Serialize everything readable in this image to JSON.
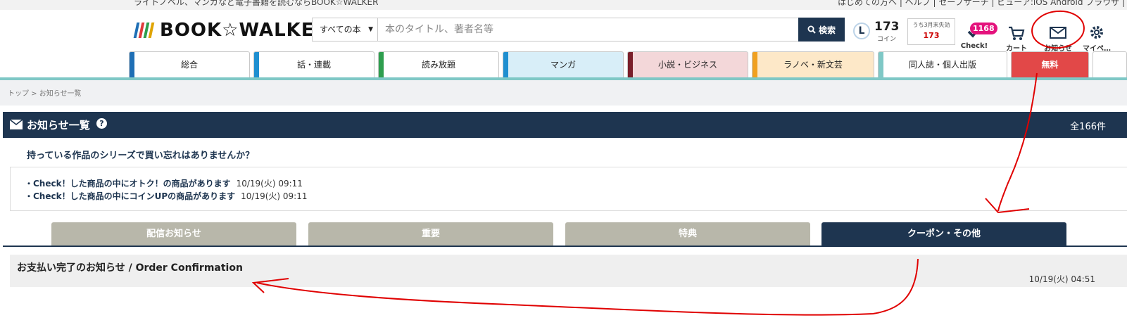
{
  "top_links": {
    "left_text": "ライトノベル、マンガなど電子書籍を読むならBOOK☆WALKER",
    "right_text": "はじめての方へ | ヘルプ | セーブサーチ | ビューア:iOS Android ブラウザ | …"
  },
  "logo": {
    "text": "BOOK☆WALKER",
    "bar_colors": [
      "#1f6fb5",
      "#e03a3a",
      "#2e9e4e",
      "#e0a400"
    ]
  },
  "search": {
    "scope_label": "すべての本",
    "placeholder": "本のタイトル、著者名等",
    "button_label": "検索"
  },
  "coin": {
    "rank_letter": "L",
    "amount": "173",
    "label": "コイン"
  },
  "expiring": {
    "label": "うち3月末失効",
    "amount": "173"
  },
  "header_icons": {
    "check": {
      "label": "Check!",
      "badge": "1168"
    },
    "cart": {
      "label": "カート"
    },
    "notice": {
      "label": "お知らせ"
    },
    "mypage": {
      "label": "マイペ…"
    }
  },
  "nav_tabs": [
    {
      "label": "総合",
      "color": "#2b3d5c",
      "stripe": "#1f6fb5",
      "bg": "#ffffff"
    },
    {
      "label": "話・連載",
      "color": "#1f6fb5",
      "stripe": "#1f8fd0",
      "bg": "#ffffff"
    },
    {
      "label": "読み放題",
      "color": "#2e9e4e",
      "stripe": "#2e9e4e",
      "bg": "#ffffff"
    },
    {
      "label": "マンガ",
      "color": "#1f8fd0",
      "stripe": "#1f8fd0",
      "bg": "#d8eef8"
    },
    {
      "label": "小説・ビジネス",
      "color": "#7a1f2a",
      "stripe": "#7a1f2a",
      "bg": "#f3d7d9"
    },
    {
      "label": "ラノベ・新文芸",
      "color": "#e0a400",
      "stripe": "#f0a020",
      "bg": "#fde8c8"
    },
    {
      "label": "同人誌・個人出版",
      "color": "#7fc8c6",
      "stripe": "#7fc8c6",
      "bg": "#ffffff"
    },
    {
      "label": "無料",
      "color": "#e24848",
      "stripe": "#e24848",
      "bg": "#e24848"
    }
  ],
  "breadcrumb": "トップ > お知らせ一覧",
  "panel": {
    "title": "お知らせ一覧",
    "help": "?",
    "count": "全166件"
  },
  "suggestion": "持っている作品のシリーズで買い忘れはありませんか？",
  "notifications": [
    {
      "text": "・Check！した商品の中にオトク！の商品があります",
      "date": "10/19(火) 09:11"
    },
    {
      "text": "・Check！した商品の中にコインUPの商品があります",
      "date": "10/19(火) 09:11"
    }
  ],
  "category_tabs": [
    {
      "label": "配信お知らせ",
      "active": false
    },
    {
      "label": "重要",
      "active": false
    },
    {
      "label": "特典",
      "active": false
    },
    {
      "label": "クーポン・その他",
      "active": true
    }
  ],
  "messages": [
    {
      "title": "お支払い完了のお知らせ / Order Confirmation",
      "date": "10/19(火) 04:51"
    }
  ],
  "colors": {
    "navy": "#1e3550",
    "tab_gray": "#b8b7aa",
    "teal_line": "#7fc8c6",
    "annotation_red": "#e00000"
  }
}
